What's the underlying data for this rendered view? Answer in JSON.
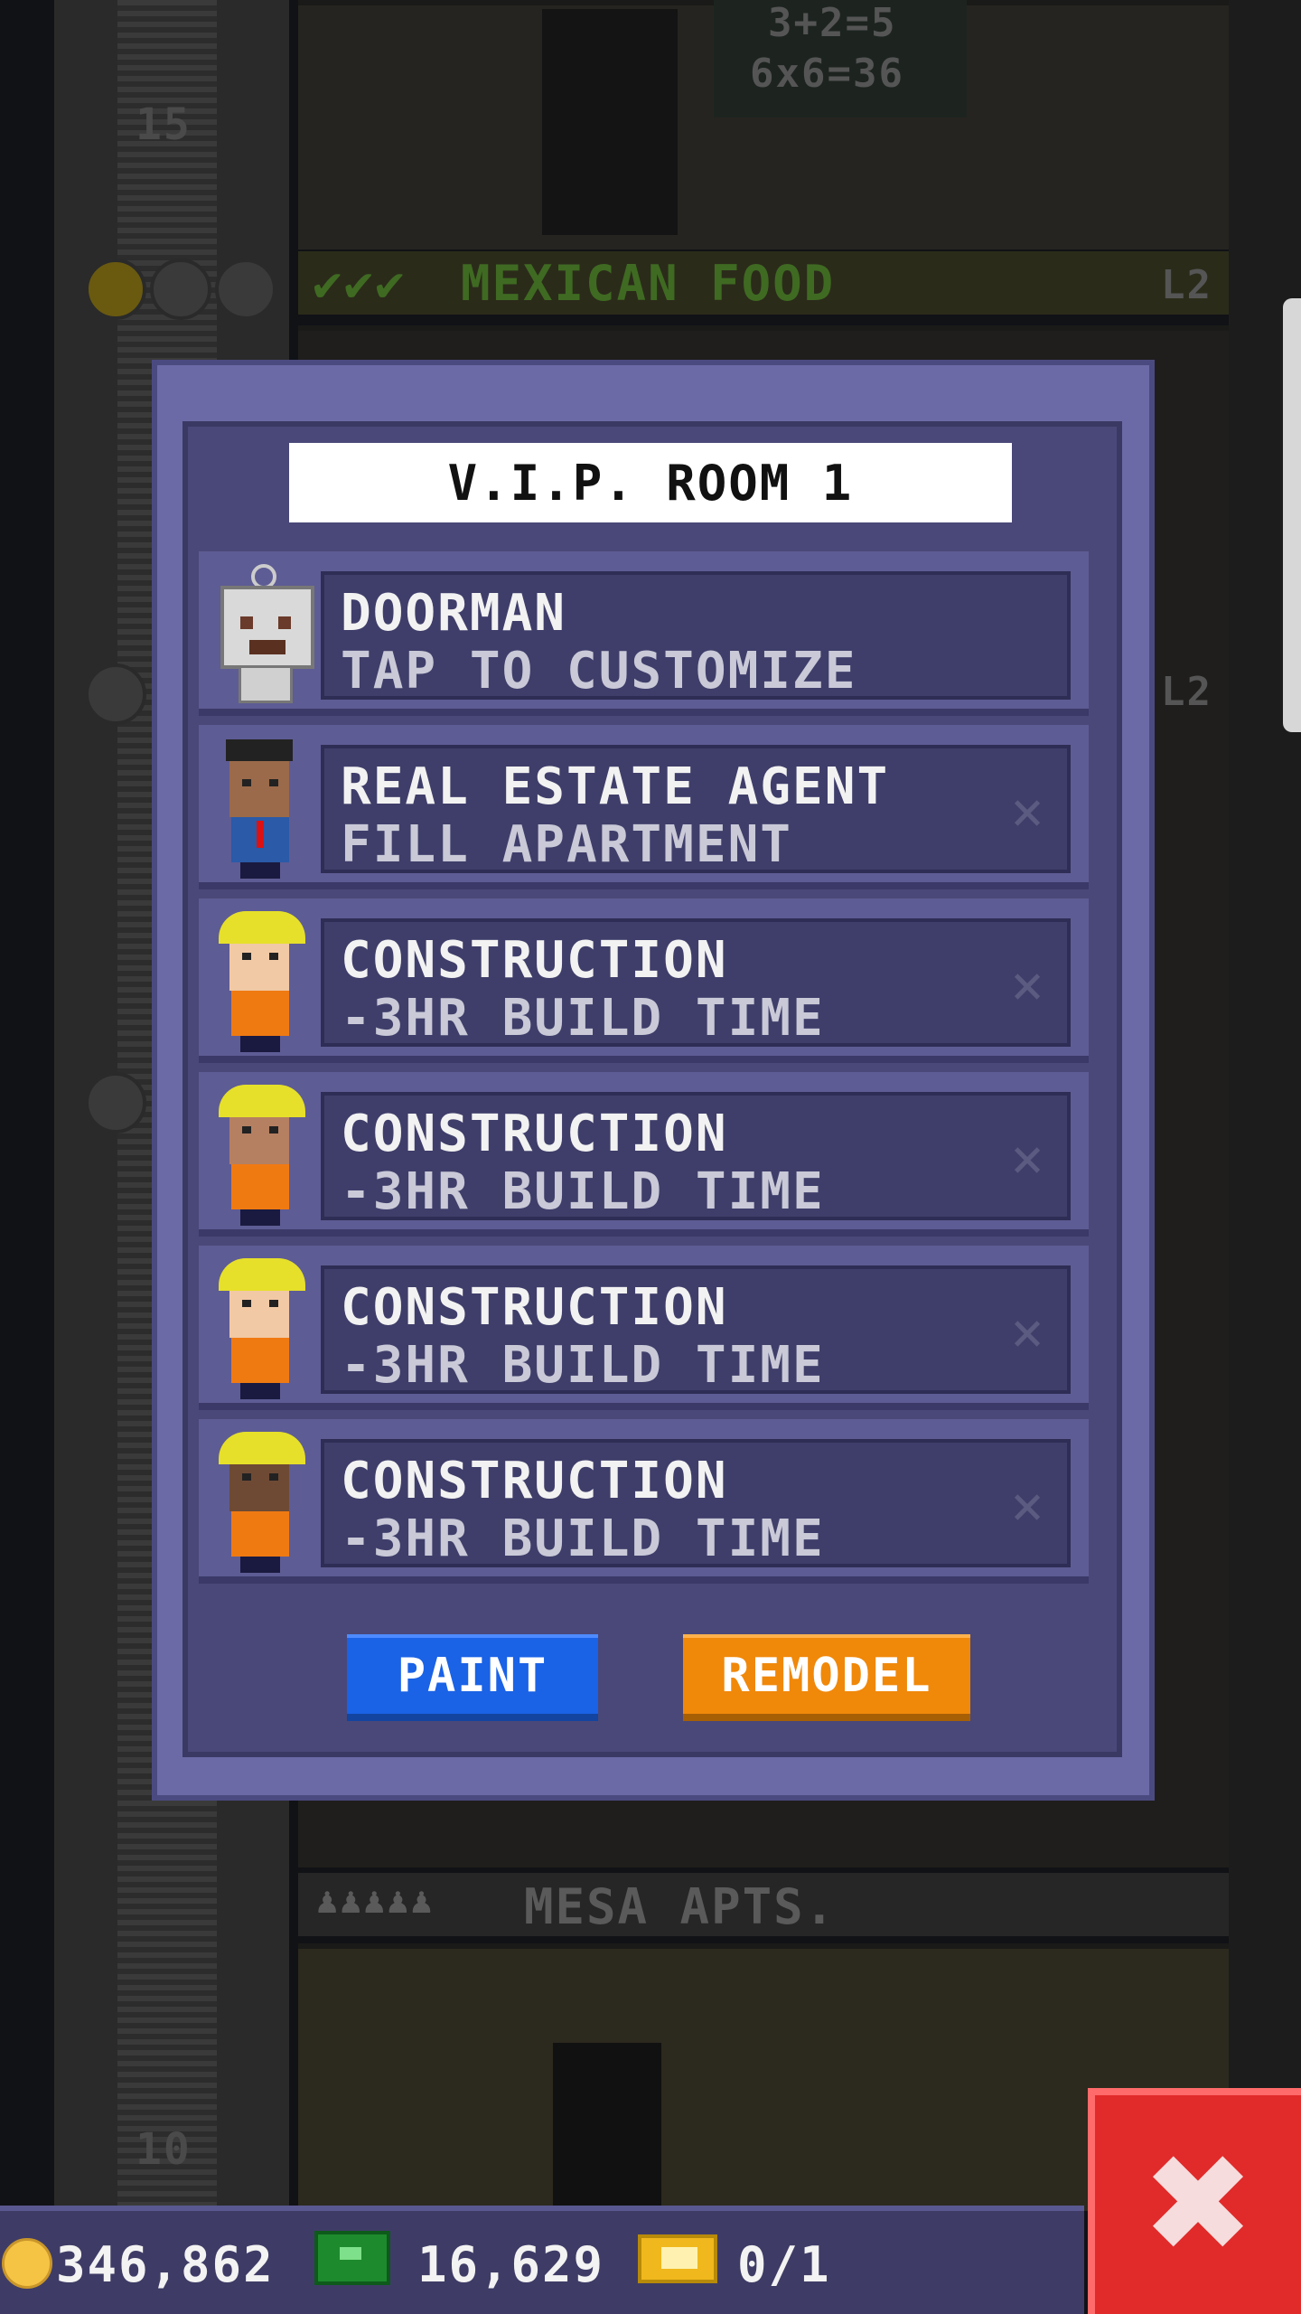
{
  "background": {
    "floors": [
      {
        "number": "15",
        "name": "MEXICAN FOOD",
        "level": "L2",
        "checks": 3
      },
      {
        "number": "10",
        "name": "MESA APTS.",
        "level": ""
      }
    ],
    "blackboard": [
      "3+2=5",
      "6x6=36"
    ],
    "level_tag_mid": "L2"
  },
  "modal": {
    "title": "V.I.P. ROOM 1",
    "rows": [
      {
        "name": "DOORMAN",
        "detail": "TAP TO CUSTOMIZE",
        "avatar": "robot",
        "removable": false
      },
      {
        "name": "REAL ESTATE AGENT",
        "detail": "FILL APARTMENT",
        "avatar": "agent",
        "removable": true
      },
      {
        "name": "CONSTRUCTION",
        "detail": "-3HR BUILD TIME",
        "avatar": "worker-light",
        "removable": true
      },
      {
        "name": "CONSTRUCTION",
        "detail": "-3HR BUILD TIME",
        "avatar": "worker-medium",
        "removable": true
      },
      {
        "name": "CONSTRUCTION",
        "detail": "-3HR BUILD TIME",
        "avatar": "worker-light",
        "removable": true
      },
      {
        "name": "CONSTRUCTION",
        "detail": "-3HR BUILD TIME",
        "avatar": "worker-dark",
        "removable": true
      }
    ],
    "remove_glyph": "×",
    "paint_label": "PAINT",
    "remodel_label": "REMODEL"
  },
  "status": {
    "coins": "346,862",
    "bux": "16,629",
    "tickets": "0/1"
  },
  "close_glyph": "✖",
  "colors": {
    "modal_bg": "#6c6aa6",
    "row_panel": "#3f3e6a",
    "paint_button": "#1a62e6",
    "remodel_button": "#f0880a",
    "close_button": "#e12a2a"
  }
}
